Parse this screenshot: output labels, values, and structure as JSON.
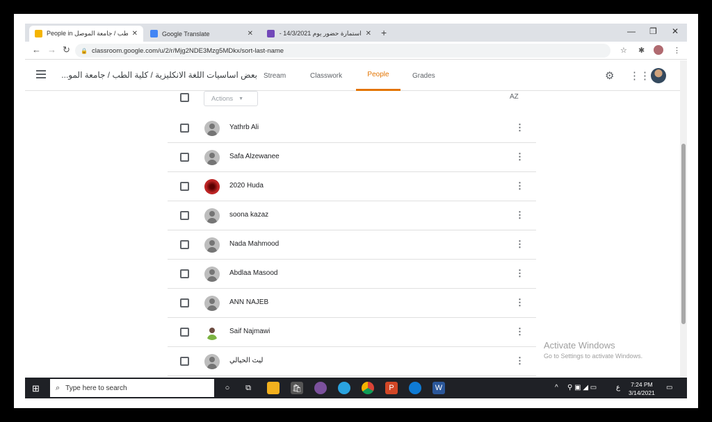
{
  "browser": {
    "tabs": [
      {
        "title": "People in الطب / جامعة الموصل ...",
        "icon": "classroom-icon",
        "color": "#f4b400",
        "active": true
      },
      {
        "title": "Google Translate",
        "icon": "translate-icon",
        "color": "#4285f4",
        "active": false
      },
      {
        "title": "استمارة حضور يوم 14/3/2021 - ...",
        "icon": "forms-icon",
        "color": "#7248b9",
        "active": false
      }
    ],
    "url": "classroom.google.com/u/2/r/Mjg2NDE3Mzg5MDkx/sort-last-name"
  },
  "header": {
    "class_name": "بعض اساسيات اللغة الانكليزية / كلية الطب / جامعة المو...",
    "tabs": [
      "Stream",
      "Classwork",
      "People",
      "Grades"
    ],
    "active_tab": "People"
  },
  "people": {
    "actions_label": "Actions",
    "sort_label": "A͏Z",
    "students": [
      {
        "name": "Yathrb Ali",
        "avatar": "default"
      },
      {
        "name": "Safa Alzewanee",
        "avatar": "default"
      },
      {
        "name": "2020 Huda",
        "avatar": "red"
      },
      {
        "name": "soona kazaz",
        "avatar": "default"
      },
      {
        "name": "Nada Mahmood",
        "avatar": "default"
      },
      {
        "name": "Abdlaa Masood",
        "avatar": "default"
      },
      {
        "name": "ANN NAJEB",
        "avatar": "default"
      },
      {
        "name": "Saif Najmawi",
        "avatar": "photo"
      },
      {
        "name": "ليث الحيالي",
        "avatar": "default"
      }
    ]
  },
  "watermark": {
    "line1": "Activate Windows",
    "line2": "Go to Settings to activate Windows."
  },
  "taskbar": {
    "search_placeholder": "Type here to search",
    "time": "7:24 PM",
    "date": "3/14/2021",
    "lang": "ع"
  }
}
